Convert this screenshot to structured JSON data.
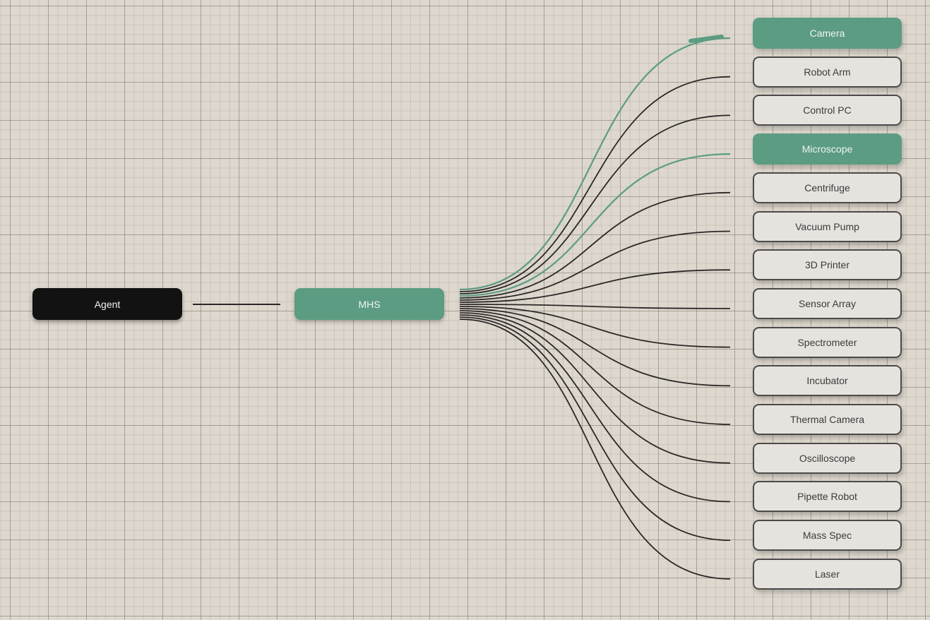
{
  "agent": {
    "label": "Agent"
  },
  "hub": {
    "label": "MHS"
  },
  "colors": {
    "active": "#5c9c82",
    "wire": "#2a2827",
    "agent_fill": "#121212"
  },
  "devices": [
    {
      "label": "Camera",
      "active": true
    },
    {
      "label": "Robot Arm",
      "active": false
    },
    {
      "label": "Control PC",
      "active": false
    },
    {
      "label": "Microscope",
      "active": true
    },
    {
      "label": "Centrifuge",
      "active": false
    },
    {
      "label": "Vacuum Pump",
      "active": false
    },
    {
      "label": "3D Printer",
      "active": false
    },
    {
      "label": "Sensor Array",
      "active": false
    },
    {
      "label": "Spectrometer",
      "active": false
    },
    {
      "label": "Incubator",
      "active": false
    },
    {
      "label": "Thermal Camera",
      "active": false
    },
    {
      "label": "Oscilloscope",
      "active": false
    },
    {
      "label": "Pipette Robot",
      "active": false
    },
    {
      "label": "Mass Spec",
      "active": false
    },
    {
      "label": "Laser",
      "active": false
    }
  ]
}
